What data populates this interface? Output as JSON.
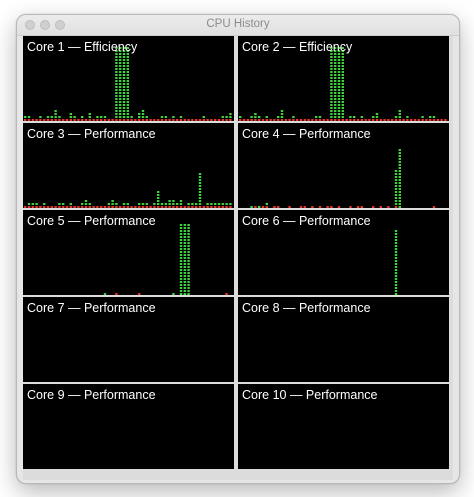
{
  "window": {
    "title": "CPU History"
  },
  "colors": {
    "user": "#3fd23f",
    "system": "#e8332a",
    "background": "#000000"
  },
  "cores": [
    {
      "label": "Core 1 — Efficiency",
      "sys": [
        1,
        1,
        1,
        1,
        1,
        1,
        1,
        1,
        1,
        1,
        1,
        1,
        1,
        1,
        1,
        1,
        1,
        1,
        1,
        1,
        1,
        1,
        1,
        1,
        1,
        1,
        1,
        1,
        1,
        1,
        1,
        1,
        1,
        1,
        1,
        1,
        1,
        1,
        1,
        1,
        1,
        1,
        1,
        1,
        1,
        1,
        1,
        1,
        1,
        1,
        1,
        1,
        1,
        1,
        1
      ],
      "usr": [
        1,
        1,
        0,
        0,
        1,
        0,
        1,
        1,
        3,
        1,
        0,
        0,
        2,
        1,
        0,
        1,
        0,
        2,
        0,
        1,
        1,
        1,
        0,
        0,
        24,
        24,
        24,
        24,
        1,
        0,
        2,
        3,
        1,
        0,
        0,
        0,
        1,
        1,
        0,
        1,
        0,
        1,
        0,
        0,
        0,
        0,
        0,
        1,
        0,
        0,
        0,
        0,
        1,
        1,
        2
      ]
    },
    {
      "label": "Core 2 — Efficiency",
      "sys": [
        1,
        1,
        1,
        1,
        1,
        1,
        1,
        1,
        1,
        1,
        1,
        1,
        1,
        1,
        1,
        1,
        1,
        1,
        1,
        1,
        1,
        1,
        1,
        1,
        1,
        1,
        1,
        1,
        1,
        1,
        1,
        1,
        1,
        1,
        1,
        1,
        1,
        1,
        1,
        1,
        1,
        1,
        1,
        1,
        1,
        1,
        1,
        1,
        1,
        1,
        1,
        1,
        1,
        1,
        1
      ],
      "usr": [
        1,
        0,
        0,
        1,
        2,
        1,
        0,
        1,
        0,
        0,
        1,
        3,
        0,
        0,
        1,
        0,
        0,
        0,
        0,
        0,
        1,
        1,
        0,
        0,
        3,
        2,
        1,
        1,
        0,
        1,
        1,
        0,
        1,
        0,
        0,
        1,
        2,
        0,
        0,
        0,
        0,
        1,
        3,
        0,
        1,
        0,
        0,
        0,
        1,
        0,
        1,
        1,
        0,
        0,
        0
      ],
      "burst": [
        24,
        25,
        26,
        27
      ]
    },
    {
      "label": "Core 3 — Performance",
      "sys": [
        1,
        1,
        1,
        1,
        1,
        1,
        1,
        1,
        1,
        1,
        1,
        1,
        1,
        1,
        1,
        1,
        1,
        1,
        1,
        1,
        1,
        1,
        1,
        1,
        1,
        1,
        1,
        1,
        1,
        1,
        1,
        1,
        1,
        1,
        1,
        1,
        1,
        1,
        1,
        1,
        1,
        1,
        1,
        1,
        1,
        1,
        1,
        1,
        1,
        1,
        1,
        1,
        1,
        1,
        1
      ],
      "usr": [
        0,
        1,
        1,
        1,
        0,
        1,
        0,
        0,
        0,
        1,
        1,
        0,
        1,
        0,
        0,
        1,
        2,
        1,
        0,
        0,
        0,
        0,
        1,
        2,
        1,
        0,
        1,
        1,
        0,
        0,
        1,
        1,
        1,
        0,
        1,
        5,
        1,
        1,
        2,
        2,
        1,
        2,
        0,
        1,
        1,
        1,
        11,
        0,
        1,
        1,
        1,
        1,
        1,
        1,
        1
      ]
    },
    {
      "label": "Core 4 — Performance",
      "sys": [
        0,
        0,
        0,
        0,
        1,
        0,
        1,
        1,
        0,
        1,
        1,
        0,
        0,
        1,
        0,
        0,
        1,
        1,
        0,
        1,
        0,
        1,
        0,
        1,
        1,
        0,
        1,
        0,
        0,
        1,
        0,
        1,
        1,
        0,
        0,
        1,
        0,
        1,
        0,
        1,
        0,
        1,
        0,
        0,
        0,
        0,
        0,
        0,
        0,
        0,
        0,
        1,
        0,
        0,
        0
      ],
      "usr": [
        0,
        0,
        0,
        1,
        0,
        1,
        0,
        1,
        0,
        0,
        0,
        0,
        0,
        0,
        0,
        0,
        0,
        0,
        0,
        0,
        0,
        0,
        0,
        0,
        0,
        0,
        0,
        0,
        0,
        0,
        0,
        0,
        0,
        0,
        0,
        0,
        0,
        0,
        0,
        0,
        0,
        0,
        0,
        0,
        0,
        0,
        0,
        0,
        0,
        0,
        0,
        0,
        0,
        0,
        0
      ],
      "spike": {
        "col": 42,
        "h": 20
      },
      "spike2": {
        "col": 41,
        "h": 12
      }
    },
    {
      "label": "Core 5 — Performance",
      "sys": [
        0,
        0,
        0,
        0,
        0,
        0,
        0,
        0,
        0,
        0,
        0,
        0,
        0,
        0,
        0,
        0,
        0,
        0,
        0,
        0,
        0,
        0,
        0,
        0,
        1,
        0,
        0,
        0,
        0,
        0,
        1,
        0,
        0,
        0,
        0,
        0,
        0,
        0,
        0,
        0,
        0,
        0,
        0,
        0,
        0,
        0,
        0,
        0,
        0,
        0,
        0,
        0,
        0,
        1,
        0
      ],
      "usr": [
        0,
        0,
        0,
        0,
        0,
        0,
        0,
        0,
        0,
        0,
        0,
        0,
        0,
        0,
        0,
        0,
        0,
        0,
        0,
        0,
        0,
        1,
        0,
        0,
        0,
        0,
        0,
        0,
        0,
        0,
        0,
        0,
        0,
        0,
        0,
        0,
        0,
        0,
        0,
        1,
        0,
        0,
        0,
        0,
        0,
        0,
        0,
        0,
        0,
        0,
        0,
        0,
        0,
        0,
        0
      ],
      "burst": [
        41,
        42,
        43
      ]
    },
    {
      "label": "Core 6 — Performance",
      "sys": [
        0,
        0,
        0,
        0,
        0,
        0,
        0,
        0,
        0,
        0,
        0,
        0,
        0,
        0,
        0,
        0,
        0,
        0,
        0,
        0,
        0,
        0,
        0,
        0,
        0,
        0,
        0,
        0,
        0,
        0,
        0,
        0,
        0,
        0,
        0,
        0,
        0,
        0,
        0,
        0,
        0,
        0,
        0,
        0,
        0,
        0,
        0,
        0,
        0,
        0,
        0,
        0,
        0,
        0,
        0
      ],
      "usr": [
        0,
        0,
        0,
        0,
        0,
        0,
        0,
        0,
        0,
        0,
        0,
        0,
        0,
        0,
        0,
        0,
        0,
        0,
        0,
        0,
        0,
        0,
        0,
        0,
        0,
        0,
        0,
        0,
        0,
        0,
        0,
        0,
        0,
        0,
        0,
        0,
        0,
        0,
        0,
        0,
        0,
        0,
        0,
        0,
        0,
        0,
        0,
        0,
        0,
        0,
        0,
        0,
        0,
        0,
        0
      ],
      "spike": {
        "col": 41,
        "h": 22
      }
    },
    {
      "label": "Core 7 — Performance",
      "sys": [],
      "usr": []
    },
    {
      "label": "Core 8 — Performance",
      "sys": [],
      "usr": []
    },
    {
      "label": "Core 9 — Performance",
      "sys": [],
      "usr": []
    },
    {
      "label": "Core 10 — Performance",
      "sys": [],
      "usr": []
    }
  ]
}
